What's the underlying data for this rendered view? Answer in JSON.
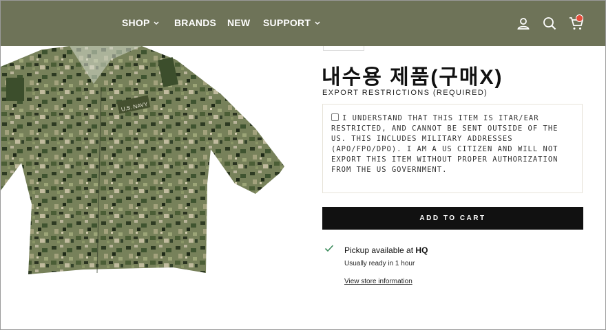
{
  "nav": {
    "shop": "SHOP",
    "brands": "BRANDS",
    "new": "NEW",
    "support": "SUPPORT"
  },
  "icons": [
    "account-icon",
    "search-icon",
    "cart-icon",
    "chevron-down-icon",
    "checkmark-icon"
  ],
  "colors": {
    "header": "#6e7358",
    "button": "#111111",
    "cart_badge": "#e44c3a",
    "check": "#3a8a5a"
  },
  "product": {
    "title": "내수용 제품(구매X)",
    "export_label": "EXPORT RESTRICTIONS (REQUIRED)",
    "restriction_text": "I UNDERSTAND THAT THIS ITEM IS ITAR/EAR RESTRICTED, AND CANNOT BE SENT OUTSIDE OF THE US. THIS INCLUDES MILITARY ADDRESSES (APO/FPO/DPO). I AM A US CITIZEN AND WILL NOT EXPORT THIS ITEM WITHOUT PROPER AUTHORIZATION FROM THE US GOVERNMENT.",
    "add_to_cart": "ADD TO CART"
  },
  "pickup": {
    "prefix": "Pickup available at ",
    "location": "HQ",
    "ready": "Usually ready in 1 hour",
    "store_link": "View store information"
  },
  "image": {
    "badge_text": "U.S. NAVY"
  }
}
